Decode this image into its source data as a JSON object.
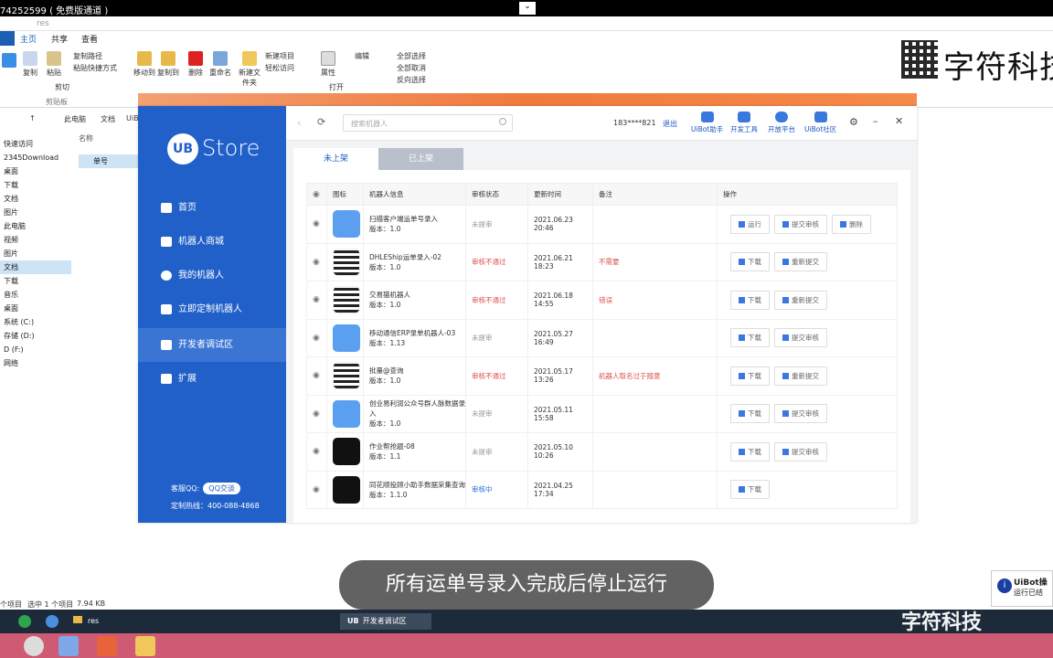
{
  "window": {
    "title": "74252599 ( 免费版通道 )",
    "restore": "⌄"
  },
  "explorer": {
    "path_title": "res",
    "tabs": [
      "主页",
      "共享",
      "查看"
    ],
    "ribbon": {
      "pin": "固定\"快速访问\"",
      "copy": "复制",
      "paste": "粘贴",
      "copy_path": "复制路径",
      "paste_shortcut": "粘贴快捷方式",
      "cut": "剪切",
      "clipboard": "剪贴板",
      "move_to": "移动到",
      "copy_to": "复制到",
      "delete": "删除",
      "rename": "重命名",
      "new_folder": "新建文件夹",
      "new_item": "新建项目",
      "easy_access": "轻松访问",
      "properties": "属性",
      "open": "打开",
      "edit": "编辑",
      "select_all": "全部选择",
      "select_none": "全部取消",
      "invert": "反向选择"
    },
    "address": [
      "此电脑",
      "文档",
      "UiB"
    ],
    "nav": [
      "快速访问",
      "2345Download",
      "桌面",
      "下载",
      "文档",
      "图片",
      "此电脑",
      "视频",
      "图片",
      "文档",
      "下载",
      "音乐",
      "桌面",
      "系统 (C:)",
      "存储 (D:)",
      "D (F:)",
      "网络"
    ],
    "col_name": "名称",
    "file": "单号",
    "status": {
      "items": "个项目",
      "selected": "选中 1 个项目",
      "size": "7.94 KB"
    }
  },
  "logo_text": "字符科技",
  "app": {
    "brand_ub": "UB",
    "brand_store": "Store",
    "nav": [
      "首页",
      "机器人商城",
      "我的机器人",
      "立即定制机器人",
      "开发者调试区",
      "扩展"
    ],
    "active_nav": 4,
    "support_label": "客服QQ:",
    "qq_btn": "QQ交谈",
    "hotline": "定制热线：400-088-4868",
    "search_placeholder": "搜索机器人",
    "phone": "183****821",
    "logout": "退出",
    "tools": [
      "UiBot助手",
      "开发工具",
      "开放平台",
      "UiBot社区"
    ],
    "tabs": [
      "未上架",
      "已上架"
    ],
    "columns": [
      "图标",
      "机器人信息",
      "审核状态",
      "更新时间",
      "备注",
      "操作"
    ],
    "version_prefix": "版本：",
    "rows": [
      {
        "name": "扫描客户端运单号录入",
        "version": "1.0",
        "status": "未提审",
        "status_type": "pend",
        "time": "2021.06.23 20:46",
        "note": "",
        "icon": "blue",
        "actions": [
          "运行",
          "提交审核",
          "删除"
        ]
      },
      {
        "name": "DHLEShip运单录入-02",
        "version": "1.0",
        "status": "审核不通过",
        "status_type": "rej",
        "time": "2021.06.21 18:23",
        "note": "不需要",
        "icon": "qr",
        "actions": [
          "下载",
          "重新提交"
        ]
      },
      {
        "name": "交易猫机器人",
        "version": "1.0",
        "status": "审核不通过",
        "status_type": "rej",
        "time": "2021.06.18 14:55",
        "note": "错误",
        "icon": "qr",
        "actions": [
          "下载",
          "重新提交"
        ]
      },
      {
        "name": "移动通信ERP录单机器人-03",
        "version": "1.13",
        "status": "未提审",
        "status_type": "pend",
        "time": "2021.05.27 16:49",
        "note": "",
        "icon": "blue",
        "actions": [
          "下载",
          "提交审核"
        ]
      },
      {
        "name": "批量@查询",
        "version": "1.0",
        "status": "审核不通过",
        "status_type": "rej",
        "time": "2021.05.17 13:26",
        "note": "机器人取名过于随意",
        "icon": "qr",
        "actions": [
          "下载",
          "重新提交"
        ]
      },
      {
        "name": "创业易利润公众号群人脉数据录入",
        "version": "1.0",
        "status": "未提审",
        "status_type": "pend",
        "time": "2021.05.11 15:58",
        "note": "",
        "icon": "blue",
        "actions": [
          "下载",
          "提交审核"
        ]
      },
      {
        "name": "作业帮抢题-08",
        "version": "1.1",
        "status": "未提审",
        "status_type": "pend",
        "time": "2021.05.10 10:26",
        "note": "",
        "icon": "black",
        "actions": [
          "下载",
          "提交审核"
        ]
      },
      {
        "name": "同花顺投顾小助手数据采集查询",
        "version": "1.1.0",
        "status": "审核中",
        "status_type": "rev",
        "time": "2021.04.25 17:34",
        "note": "",
        "icon": "black",
        "actions": [
          "下载"
        ]
      }
    ]
  },
  "subtitle": "所有运单号录入完成后停止运行",
  "notification": {
    "title": "UiBot操",
    "body": "运行已结"
  },
  "taskbar": {
    "folder": "res",
    "active": "开发者调试区",
    "watermark": "字符科技"
  },
  "colors": {
    "sidebar": "#2060c8",
    "accent": "#f07a3e",
    "reject": "#d9534f"
  }
}
